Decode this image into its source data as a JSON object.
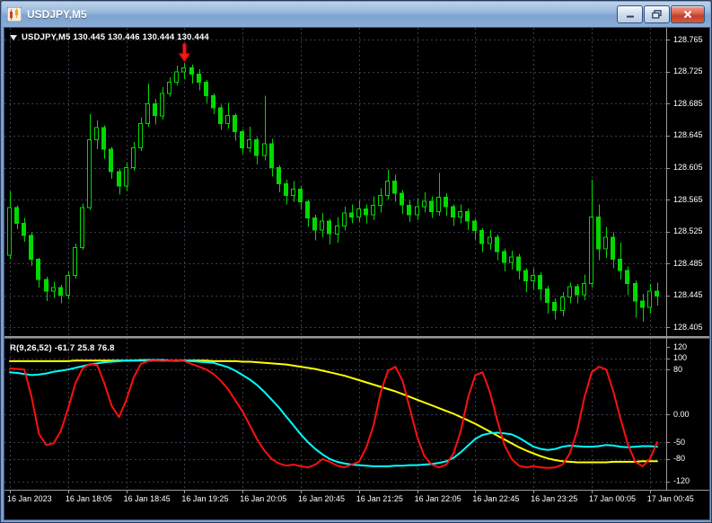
{
  "window": {
    "title": "USDJPY,M5",
    "icon": "candlestick-chart-icon",
    "controls": [
      "minimize",
      "restore",
      "close"
    ]
  },
  "chart": {
    "header_text": "USDJPY,M5 130.445 130.446 130.444 130.444",
    "symbol": "USDJPY",
    "timeframe": "M5",
    "ohlc": {
      "open": "130.445",
      "high": "130.446",
      "low": "130.444",
      "close": "130.444"
    }
  },
  "indicator": {
    "label": "R(9,26,52) -61.7 25.8 76.8",
    "name": "R",
    "parameters": "9,26,52",
    "current_values": [
      "-61.7",
      "25.8",
      "76.8"
    ]
  },
  "chart_data": [
    {
      "type": "candlestick",
      "title": "USDJPY,M5",
      "ylim": [
        128.394,
        128.78
      ],
      "y_tick_labels": [
        "128.765",
        "128.725",
        "128.685",
        "128.645",
        "128.605",
        "128.565",
        "128.525",
        "128.485",
        "128.445",
        "128.405"
      ],
      "y_tick_values": [
        128.765,
        128.725,
        128.685,
        128.645,
        128.605,
        128.565,
        128.525,
        128.485,
        128.445,
        128.405
      ],
      "x_tick_labels": [
        "16 Jan 2023",
        "16 Jan 18:05",
        "16 Jan 18:45",
        "16 Jan 19:25",
        "16 Jan 20:05",
        "16 Jan 20:45",
        "16 Jan 21:25",
        "16 Jan 22:05",
        "16 Jan 22:45",
        "16 Jan 23:25",
        "17 Jan 00:05",
        "17 Jan 00:45"
      ],
      "x_ticks_every_n_candles": 8,
      "grid": true,
      "colors": {
        "up": "#00d900",
        "down": "#00d900",
        "background": "#000000",
        "grid": "#3c3c4e",
        "axis_text": "#ffffff"
      },
      "annotations": [
        {
          "type": "arrow-down",
          "color": "#f01818",
          "candle_index": 24,
          "price": 128.737
        }
      ],
      "candles_ohlc": [
        [
          128.495,
          128.575,
          128.49,
          128.555
        ],
        [
          128.555,
          128.558,
          128.528,
          128.535
        ],
        [
          128.535,
          128.542,
          128.512,
          128.52
        ],
        [
          128.52,
          128.524,
          128.482,
          128.49
        ],
        [
          128.49,
          128.492,
          128.455,
          128.465
        ],
        [
          128.465,
          128.468,
          128.438,
          128.45
        ],
        [
          128.45,
          128.462,
          128.442,
          128.455
        ],
        [
          128.455,
          128.458,
          128.435,
          128.445
        ],
        [
          128.445,
          128.475,
          128.44,
          128.47
        ],
        [
          128.47,
          128.51,
          128.466,
          128.505
        ],
        [
          128.505,
          128.56,
          128.502,
          128.555
        ],
        [
          128.555,
          128.672,
          128.552,
          128.64
        ],
        [
          128.64,
          128.664,
          128.628,
          128.655
        ],
        [
          128.655,
          128.658,
          128.616,
          128.628
        ],
        [
          128.628,
          128.631,
          128.591,
          128.6
        ],
        [
          128.6,
          128.604,
          128.571,
          128.582
        ],
        [
          128.582,
          128.612,
          128.576,
          128.605
        ],
        [
          128.605,
          128.637,
          128.601,
          128.63
        ],
        [
          128.63,
          128.668,
          128.626,
          128.66
        ],
        [
          128.66,
          128.71,
          128.656,
          128.685
        ],
        [
          128.685,
          128.691,
          128.659,
          128.67
        ],
        [
          128.67,
          128.706,
          128.665,
          128.698
        ],
        [
          128.698,
          128.718,
          128.694,
          128.712
        ],
        [
          128.712,
          128.733,
          128.708,
          128.725
        ],
        [
          128.725,
          128.736,
          128.716,
          128.73
        ],
        [
          128.73,
          128.734,
          128.71,
          128.722
        ],
        [
          128.722,
          128.728,
          128.702,
          128.712
        ],
        [
          128.712,
          128.715,
          128.686,
          128.695
        ],
        [
          128.695,
          128.698,
          128.672,
          128.68
        ],
        [
          128.68,
          128.684,
          128.652,
          128.66
        ],
        [
          128.66,
          128.686,
          128.654,
          128.67
        ],
        [
          128.67,
          128.673,
          128.639,
          128.65
        ],
        [
          128.65,
          128.653,
          128.622,
          128.63
        ],
        [
          128.63,
          128.656,
          128.624,
          128.64
        ],
        [
          128.64,
          128.643,
          128.609,
          128.62
        ],
        [
          128.62,
          128.695,
          128.614,
          128.635
        ],
        [
          128.635,
          128.641,
          128.594,
          128.605
        ],
        [
          128.605,
          128.608,
          128.574,
          128.585
        ],
        [
          128.585,
          128.59,
          128.559,
          128.57
        ],
        [
          128.57,
          128.588,
          128.562,
          128.578
        ],
        [
          128.578,
          128.582,
          128.552,
          128.562
        ],
        [
          128.562,
          128.565,
          128.531,
          128.542
        ],
        [
          128.542,
          128.546,
          128.514,
          128.527
        ],
        [
          128.527,
          128.548,
          128.518,
          128.538
        ],
        [
          128.538,
          128.541,
          128.509,
          128.522
        ],
        [
          128.522,
          128.543,
          128.511,
          128.532
        ],
        [
          128.532,
          128.556,
          128.526,
          128.548
        ],
        [
          128.548,
          128.559,
          128.535,
          128.543
        ],
        [
          128.543,
          128.564,
          128.537,
          128.553
        ],
        [
          128.553,
          128.559,
          128.535,
          128.546
        ],
        [
          128.546,
          128.569,
          128.539,
          128.558
        ],
        [
          128.558,
          128.579,
          128.549,
          128.57
        ],
        [
          128.57,
          128.603,
          128.565,
          128.588
        ],
        [
          128.588,
          128.596,
          128.562,
          128.573
        ],
        [
          128.573,
          128.577,
          128.547,
          128.558
        ],
        [
          128.558,
          128.564,
          128.537,
          128.546
        ],
        [
          128.546,
          128.567,
          128.539,
          128.556
        ],
        [
          128.556,
          128.574,
          128.549,
          128.563
        ],
        [
          128.563,
          128.569,
          128.542,
          128.55
        ],
        [
          128.55,
          128.598,
          128.545,
          128.568
        ],
        [
          128.568,
          128.573,
          128.545,
          128.556
        ],
        [
          128.556,
          128.559,
          128.532,
          128.543
        ],
        [
          128.543,
          128.559,
          128.535,
          128.55
        ],
        [
          128.55,
          128.554,
          128.527,
          128.538
        ],
        [
          128.538,
          128.541,
          128.515,
          128.526
        ],
        [
          128.526,
          128.529,
          128.499,
          128.51
        ],
        [
          128.51,
          128.527,
          128.502,
          128.518
        ],
        [
          128.518,
          128.521,
          128.489,
          128.5
        ],
        [
          128.5,
          128.504,
          128.475,
          128.486
        ],
        [
          128.486,
          128.501,
          128.477,
          128.493
        ],
        [
          128.493,
          128.497,
          128.465,
          128.476
        ],
        [
          128.476,
          128.479,
          128.449,
          128.463
        ],
        [
          128.463,
          128.479,
          128.452,
          128.47
        ],
        [
          128.47,
          128.474,
          128.439,
          128.453
        ],
        [
          128.453,
          128.457,
          128.422,
          128.436
        ],
        [
          128.436,
          128.441,
          128.415,
          128.426
        ],
        [
          128.426,
          128.449,
          128.419,
          128.443
        ],
        [
          128.443,
          128.461,
          128.435,
          128.456
        ],
        [
          128.456,
          128.459,
          128.435,
          128.446
        ],
        [
          128.446,
          128.471,
          128.439,
          128.46
        ],
        [
          128.46,
          128.59,
          128.455,
          128.543
        ],
        [
          128.543,
          128.559,
          128.489,
          128.503
        ],
        [
          128.503,
          128.531,
          128.492,
          128.518
        ],
        [
          128.518,
          128.524,
          128.479,
          128.49
        ],
        [
          128.49,
          128.511,
          128.465,
          128.476
        ],
        [
          128.476,
          128.481,
          128.445,
          128.46
        ],
        [
          128.46,
          128.464,
          128.417,
          128.438
        ],
        [
          128.438,
          128.447,
          128.412,
          128.43
        ],
        [
          128.43,
          128.459,
          128.422,
          128.45
        ],
        [
          128.45,
          128.461,
          128.432,
          128.444
        ]
      ]
    },
    {
      "type": "line",
      "title": "R(9,26,52)",
      "ylim": [
        -135,
        135
      ],
      "y_tick_labels": [
        "120",
        "100",
        "80",
        "0.00",
        "-50",
        "-80",
        "-120"
      ],
      "y_tick_values": [
        120,
        100,
        80,
        0,
        -50,
        -80,
        -120
      ],
      "grid": true,
      "series": [
        {
          "name": "fast",
          "color": "#ff1010",
          "values": [
            82,
            81,
            80,
            30,
            -35,
            -55,
            -52,
            -30,
            10,
            55,
            82,
            90,
            88,
            55,
            15,
            -5,
            25,
            65,
            90,
            95,
            96,
            95,
            96,
            97,
            95,
            90,
            85,
            80,
            72,
            60,
            45,
            25,
            5,
            -20,
            -45,
            -65,
            -80,
            -88,
            -92,
            -90,
            -93,
            -95,
            -90,
            -80,
            -85,
            -92,
            -95,
            -90,
            -85,
            -60,
            -20,
            40,
            78,
            85,
            60,
            10,
            -40,
            -75,
            -90,
            -95,
            -90,
            -70,
            -30,
            30,
            70,
            75,
            40,
            -10,
            -55,
            -80,
            -92,
            -95,
            -93,
            -95,
            -96,
            -95,
            -90,
            -70,
            -30,
            30,
            75,
            85,
            80,
            40,
            -10,
            -55,
            -85,
            -93,
            -80,
            -50
          ]
        },
        {
          "name": "medium",
          "color": "#00ffff",
          "values": [
            75,
            74,
            72,
            70,
            71,
            73,
            76,
            78,
            80,
            83,
            86,
            89,
            91,
            93,
            94,
            95,
            96,
            96,
            97,
            97,
            97,
            97,
            96,
            96,
            96,
            95,
            94,
            93,
            92,
            88,
            84,
            78,
            70,
            62,
            52,
            40,
            26,
            12,
            -4,
            -20,
            -36,
            -50,
            -62,
            -72,
            -80,
            -85,
            -88,
            -90,
            -91,
            -92,
            -93,
            -93,
            -93,
            -92,
            -92,
            -91,
            -91,
            -90,
            -89,
            -87,
            -84,
            -78,
            -68,
            -56,
            -44,
            -37,
            -34,
            -33,
            -34,
            -36,
            -42,
            -50,
            -58,
            -62,
            -64,
            -62,
            -58,
            -56,
            -57,
            -58,
            -58,
            -57,
            -55,
            -56,
            -58,
            -59,
            -58,
            -57,
            -57,
            -58
          ]
        },
        {
          "name": "slow",
          "color": "#ffff00",
          "values": [
            95,
            95,
            95,
            95,
            95,
            95,
            95,
            95,
            95,
            96,
            96,
            96,
            96,
            96,
            96,
            96,
            96,
            96,
            96,
            96,
            96,
            96,
            96,
            96,
            96,
            96,
            96,
            96,
            95,
            95,
            95,
            95,
            94,
            94,
            93,
            92,
            91,
            90,
            89,
            87,
            85,
            83,
            81,
            78,
            75,
            72,
            69,
            65,
            61,
            57,
            53,
            49,
            45,
            41,
            36,
            31,
            26,
            21,
            16,
            11,
            6,
            1,
            -5,
            -11,
            -17,
            -24,
            -31,
            -38,
            -45,
            -52,
            -59,
            -65,
            -70,
            -75,
            -79,
            -82,
            -84,
            -85,
            -86,
            -86,
            -86,
            -86,
            -86,
            -85,
            -85,
            -85,
            -85,
            -84,
            -84,
            -84
          ]
        }
      ]
    }
  ]
}
